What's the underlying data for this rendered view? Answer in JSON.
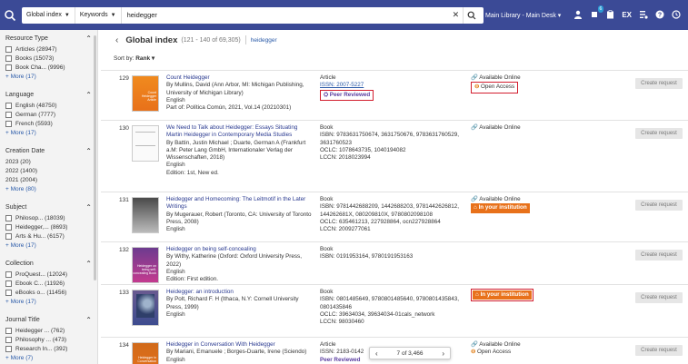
{
  "topbar": {
    "scope_label": "Global index",
    "field_label": "Keywords",
    "query": "heidegger",
    "desk": "Main Library - Main Desk",
    "tasks_badge": "6",
    "icons": [
      "search-logo-icon",
      "caret-icon",
      "clear-icon",
      "search-icon",
      "user-icon",
      "tasks-icon",
      "clipboard-icon",
      "ex-icon",
      "refine-icon",
      "help-icon",
      "history-icon"
    ],
    "ex_label": "EX"
  },
  "sidebar": {
    "facets": [
      {
        "title": "Resource Type",
        "rows": [
          {
            "label": "Articles (28947)",
            "cb": true
          },
          {
            "label": "Books (15073)",
            "cb": true
          },
          {
            "label": "Book Cha...  (9996)",
            "cb": true
          }
        ],
        "more": "+ More (17)"
      },
      {
        "title": "Language",
        "rows": [
          {
            "label": "English (48750)",
            "cb": true
          },
          {
            "label": "German (7777)",
            "cb": true
          },
          {
            "label": "French (5593)",
            "cb": true
          }
        ],
        "more": "+ More (17)"
      },
      {
        "title": "Creation Date",
        "rows": [
          {
            "label": "2023 (20)",
            "cb": false
          },
          {
            "label": "2022 (1400)",
            "cb": false
          },
          {
            "label": "2021 (2004)",
            "cb": false
          }
        ],
        "more": "+ More (80)"
      },
      {
        "title": "Subject",
        "rows": [
          {
            "label": "Philosop... (18039)",
            "cb": true
          },
          {
            "label": "Heidegger,...  (8693)",
            "cb": true
          },
          {
            "label": "Arts & Hu...  (6157)",
            "cb": true
          }
        ],
        "more": "+ More (17)"
      },
      {
        "title": "Collection",
        "rows": [
          {
            "label": "ProQuest... (12024)",
            "cb": true
          },
          {
            "label": "Ebook C... (11926)",
            "cb": true
          },
          {
            "label": "eBooks o... (11456)",
            "cb": true
          }
        ],
        "more": "+ More (17)"
      },
      {
        "title": "Journal Title",
        "rows": [
          {
            "label": "Heidegger ...  (762)",
            "cb": true
          },
          {
            "label": "Philosophy ...  (473)",
            "cb": true
          },
          {
            "label": "Research In...  (392)",
            "cb": true
          }
        ],
        "more": "+ More (7)"
      }
    ]
  },
  "main": {
    "title": "Global index",
    "count": "(121 - 140 of 69,305)",
    "query": "heidegger",
    "sort_label": "Sort by:",
    "sort_value": "Rank",
    "request_label": "Create request",
    "results": [
      {
        "num": "129",
        "cover_text": "Count Heidegger Article",
        "lines": [
          "Count Heidegger",
          "By Mullins, David (Ann Arbor, MI: Michigan Publishing, University of Michigan Library)",
          "English",
          "Part of: Política Común, 2021, Vol.14 (20210301)"
        ],
        "type": "Article",
        "issn": "ISSN: 2007-5227",
        "peer": "Peer Reviewed",
        "avail": "Available Online",
        "oa": "Open Access"
      },
      {
        "num": "130",
        "lines": [
          "We Need to Talk about Heidegger: Essays Situating Martin Heidegger in Contemporary Media Studies",
          "By Battin, Justin Michael ; Duarte, German A (Frankfurt a.M: Peter Lang GmbH, Internationaler Verlag der Wissenschaften, 2018)",
          "English",
          "Edition: 1st, New ed."
        ],
        "meta": [
          "Book",
          "ISBN: 9783631750674, 3631750676, 9783631760529, 3631760523",
          "OCLC: 1078643735, 1040194082",
          "LCCN: 2018023994"
        ],
        "avail": "Available Online"
      },
      {
        "num": "131",
        "lines": [
          "Heidegger and Homecoming: The Leitmotif in the Later Writings",
          "By Mugerauer, Robert (Toronto, CA: University of Toronto Press, 2008)",
          "English"
        ],
        "meta": [
          "Book",
          "ISBN: 9781442688209, 1442688203, 9781442626812, 144262681X, 080209810X, 9780802098108",
          "OCLC: 635461213, 227928864, ocn227928864",
          "LCCN: 2009277061"
        ],
        "avail": "Available Online",
        "inst": "In your institution"
      },
      {
        "num": "132",
        "cover_text": "Heidegger on being self-concealing Book",
        "lines": [
          "Heidegger on being self-concealing",
          "By Withy, Katherine (Oxford: Oxford University Press, 2022)",
          "English",
          "Edition: First edition."
        ],
        "meta": [
          "Book",
          "ISBN: 0191953164, 9780191953163"
        ]
      },
      {
        "num": "133",
        "lines": [
          "Heidegger: an introduction",
          "By Polt, Richard F. H (Ithaca, N.Y: Cornell University Press, 1999)",
          "English"
        ],
        "meta": [
          "Book",
          "ISBN: 0801485649, 9780801485640, 9780801435843, 0801435846",
          "OCLC: 39634034, 39634034-01cals_network",
          "LCCN: 98030460"
        ],
        "inst": "In your institution"
      },
      {
        "num": "134",
        "cover_text": "Heidegger in Conversation",
        "lines": [
          "Heidegger in Conversation With Heidegger",
          "By Mariani, Emanuele ; Borges-Duarte, Irene (Sciendo)",
          "English"
        ],
        "meta": [
          "Article",
          "ISSN: 2183-0142",
          "Peer Reviewed"
        ],
        "avail": "Available Online",
        "oa": "Open Access"
      }
    ],
    "pager": "7 of 3,466"
  }
}
